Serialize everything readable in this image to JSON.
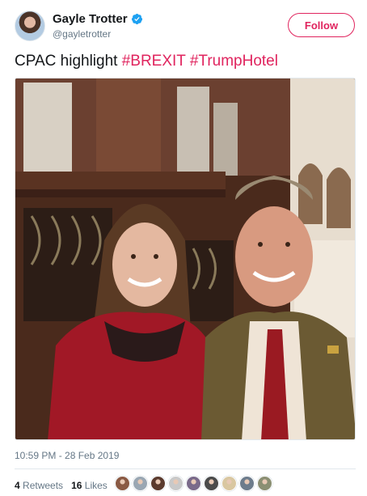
{
  "author": {
    "display_name": "Gayle Trotter",
    "handle": "@gayletrotter",
    "avatar_icon": "profile-photo",
    "verified_icon": "verified-badge-icon"
  },
  "follow_button": {
    "label": "Follow"
  },
  "tweet": {
    "text_plain": "CPAC highlight ",
    "hashtags": [
      "#BREXIT",
      "#TrumpHotel"
    ],
    "hashtag_color": "#e0245e"
  },
  "photo": {
    "icon": "tweet-photo"
  },
  "timestamp": "10:59 PM - 28 Feb 2019",
  "stats": {
    "retweets_count": "4",
    "retweets_label": "Retweets",
    "likes_count": "16",
    "likes_label": "Likes"
  },
  "likers": {
    "count_shown": 9,
    "colors": [
      "#8a5a44",
      "#9aa7b3",
      "#5b3b2e",
      "#c9c9c9",
      "#7a6a8a",
      "#4b4b4b",
      "#d9c7a1",
      "#6d7c8c",
      "#8b8f73"
    ]
  },
  "colors": {
    "accent": "#e0245e",
    "text_primary": "#14171a",
    "text_secondary": "#657786",
    "border": "#e1e8ed",
    "verified": "#1da1f2"
  }
}
